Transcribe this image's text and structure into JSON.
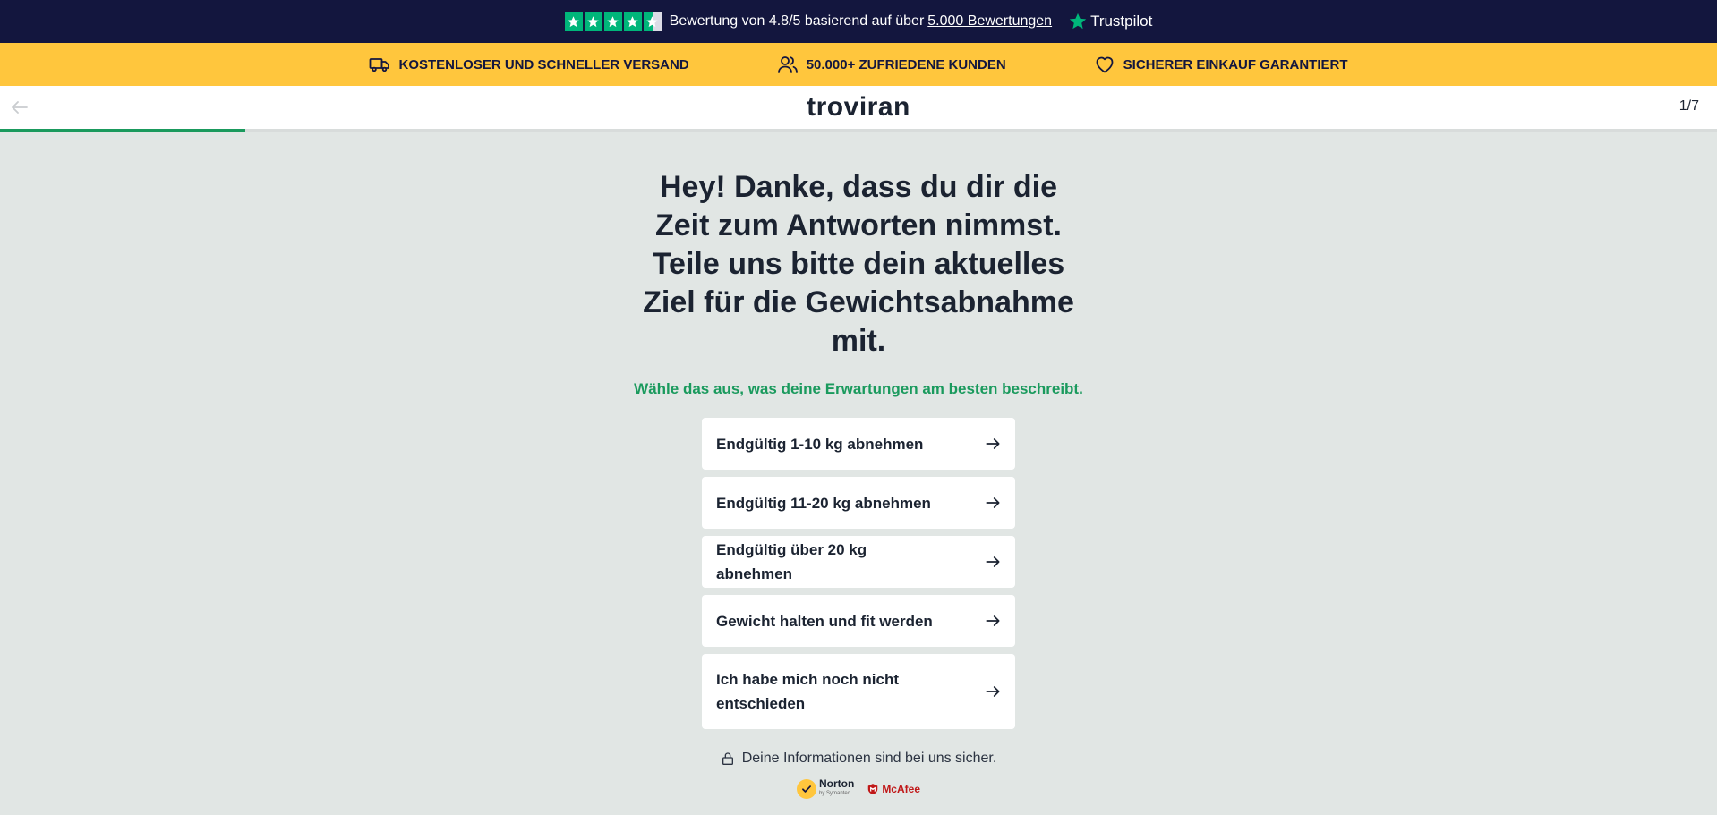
{
  "topbar": {
    "rating_text": "Bewertung von 4.8/5 basierend auf über",
    "reviews_link": "5.000 Bewertungen",
    "trustpilot_label": "Trustpilot",
    "stars": 4.5,
    "star_color": "#00b67a"
  },
  "benefits": [
    {
      "icon": "truck-icon",
      "label": "KOSTENLOSER UND SCHNELLER VERSAND"
    },
    {
      "icon": "users-icon",
      "label": "50.000+ ZUFRIEDENE KUNDEN"
    },
    {
      "icon": "heart-icon",
      "label": "SICHERER EINKAUF GARANTIERT"
    }
  ],
  "header": {
    "brand": "troviran",
    "step": "1/7",
    "progress": 0.143
  },
  "main": {
    "title": "Hey! Danke, dass du dir die Zeit zum Antworten nimmst. Teile uns bitte dein aktuelles Ziel für die Gewichtsabnahme mit.",
    "subtitle": "Wähle das aus, was deine Erwartungen am besten beschreibt.",
    "options": [
      {
        "label": "Endgültig 1-10 kg abnehmen"
      },
      {
        "label": "Endgültig 11-20 kg abnehmen"
      },
      {
        "label": "Endgültig über 20 kg abnehmen"
      },
      {
        "label": "Gewicht halten und fit werden"
      },
      {
        "label": "Ich habe mich noch nicht entschieden"
      }
    ],
    "secure_text": "Deine Informationen sind bei uns sicher."
  },
  "badges": {
    "norton": "Norton",
    "norton_sub": "by Symantec",
    "mcafee": "McAfee"
  },
  "colors": {
    "navy": "#13163e",
    "yellow": "#ffc63d",
    "green": "#1a9a5d",
    "background": "#e1e6e4"
  }
}
